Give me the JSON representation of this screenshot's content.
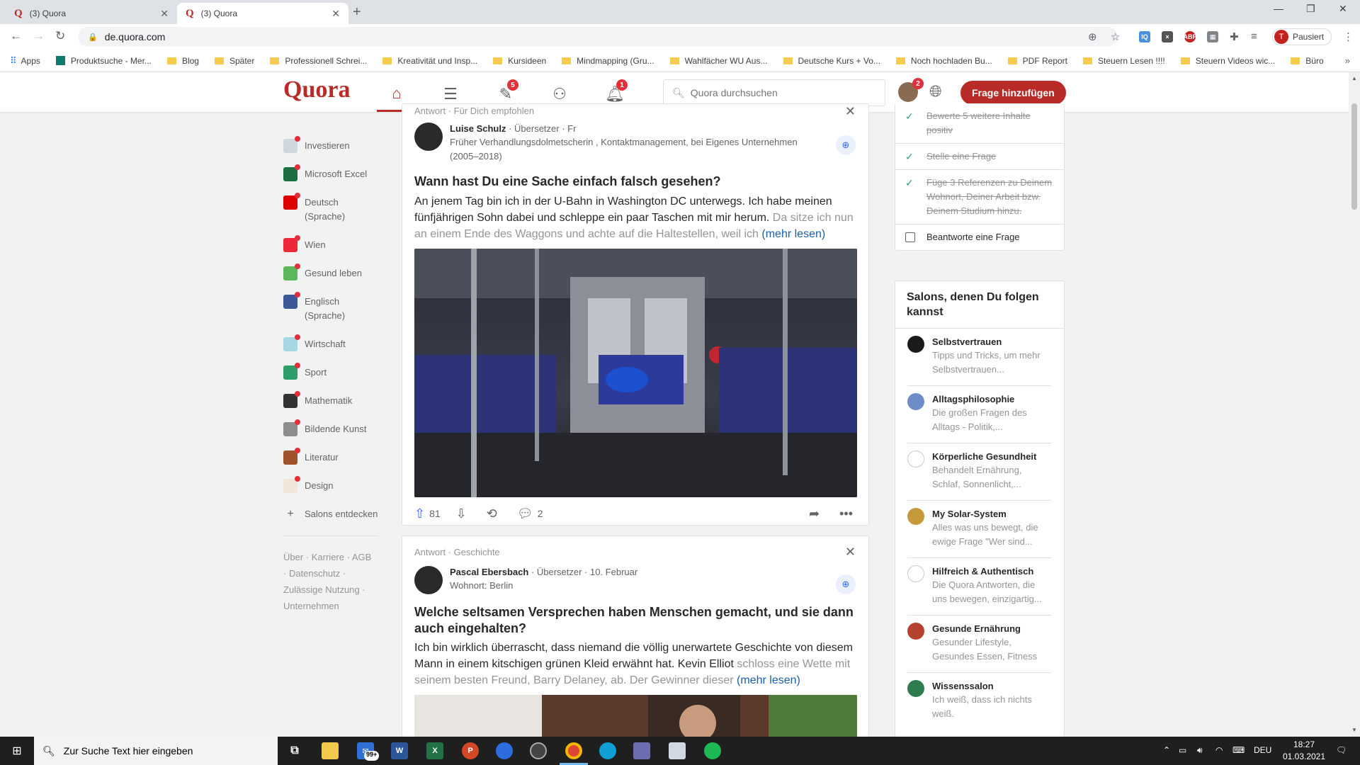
{
  "browser": {
    "tabs": [
      {
        "title": "(3) Quora",
        "active": false
      },
      {
        "title": "(3) Quora",
        "active": true
      }
    ],
    "url": "de.quora.com",
    "profile_label": "Pausiert",
    "profile_initial": "T",
    "bookmarks": [
      "Apps",
      "Produktsuche - Mer...",
      "Blog",
      "Später",
      "Professionell Schrei...",
      "Kreativität und Insp...",
      "Kursideen",
      "Mindmapping (Gru...",
      "Wahlfächer WU Aus...",
      "Deutsche Kurs + Vo...",
      "Noch hochladen Bu...",
      "PDF Report",
      "Steuern Lesen !!!!",
      "Steuern Videos wic...",
      "Büro"
    ]
  },
  "quora": {
    "logo": "Quora",
    "badges": {
      "answer": "5",
      "notifications": "1",
      "avatar": "2"
    },
    "search_placeholder": "Quora durchsuchen",
    "add_question": "Frage hinzufügen",
    "accent": "#b92b27"
  },
  "sidebar": {
    "spaces": [
      {
        "label": "Investieren",
        "color": "#cfd8dc"
      },
      {
        "label": "Microsoft Excel",
        "color": "#1d6f42"
      },
      {
        "label": "Deutsch (Sprache)",
        "color": "#dd0000"
      },
      {
        "label": "Wien",
        "color": "#ed2939"
      },
      {
        "label": "Gesund leben",
        "color": "#5cb85c"
      },
      {
        "label": "Englisch (Sprache)",
        "color": "#3b5998"
      },
      {
        "label": "Wirtschaft",
        "color": "#a6d8e3"
      },
      {
        "label": "Sport",
        "color": "#2e9e6b"
      },
      {
        "label": "Mathematik",
        "color": "#333333"
      },
      {
        "label": "Bildende Kunst",
        "color": "#8d8d8d"
      },
      {
        "label": "Literatur",
        "color": "#a0522d"
      },
      {
        "label": "Design",
        "color": "#f2e6d8"
      }
    ],
    "discover_label": "Salons entdecken",
    "footer_links": [
      "Über",
      "Karriere",
      "AGB",
      "Datenschutz",
      "Zulässige Nutzung",
      "Unternehmen"
    ]
  },
  "feed": [
    {
      "meta": "Antwort · Für Dich empfohlen",
      "author": "Luise Schulz",
      "author_meta": " · Übersetzer · Fr",
      "credential": "Früher Verhandlungsdolmetscherin , Kontaktmanagement, bei Eigenes Unternehmen (2005–2018)",
      "question": "Wann hast Du eine Sache einfach falsch gesehen?",
      "text": "An jenem Tag bin ich in der U-Bahn in Washington DC unterwegs. Ich habe meinen fünfjährigen Sohn dabei und schleppe ein paar Taschen mit mir herum. ",
      "text_fade": "Da sitze ich nun an einem Ende des Waggons und achte auf die Haltestellen, weil ich",
      "more": "(mehr lesen)",
      "upvotes": "81",
      "comments": "2"
    },
    {
      "meta": "Antwort · Geschichte",
      "author": "Pascal Ebersbach",
      "author_meta": " · Übersetzer · 10. Februar",
      "credential": "Wohnort: Berlin",
      "question": "Welche seltsamen Versprechen haben Menschen gemacht, und sie dann auch eingehalten?",
      "text": "Ich bin wirklich überrascht, dass niemand die völlig unerwartete Geschichte von diesem Mann in einem kitschigen grünen Kleid erwähnt hat. Kevin Elliot ",
      "text_fade": "schloss eine Wette mit seinem besten Freund, Barry Delaney, ab. Der Gewinner dieser",
      "more": "(mehr lesen)"
    }
  ],
  "tasks": [
    {
      "label": "Bewerte 5 weitere Inhalte positiv",
      "done": true
    },
    {
      "label": "Stelle eine Frage",
      "done": true
    },
    {
      "label": "Füge 3 Referenzen zu Deinem Wohnort, Deiner Arbeit bzw. Deinem Studium hinzu.",
      "done": true
    },
    {
      "label": "Beantworte eine Frage",
      "done": false
    }
  ],
  "salons": {
    "title": "Salons, denen Du folgen kannst",
    "items": [
      {
        "name": "Selbstvertrauen",
        "desc": "Tipps und Tricks, um mehr Selbstvertrauen...",
        "color": "#1a1a1a"
      },
      {
        "name": "Alltagsphilosophie",
        "desc": "Die großen Fragen des Alltags - Politik,...",
        "color": "#6b8cc7"
      },
      {
        "name": "Körperliche Gesundheit",
        "desc": "Behandelt Ernährung, Schlaf, Sonnenlicht,...",
        "color": "#ffffff"
      },
      {
        "name": "My Solar-System",
        "desc": "Alles was uns bewegt, die ewige Frage \"Wer sind...",
        "color": "#c49a3a"
      },
      {
        "name": "Hilfreich & Authentisch",
        "desc": "Die Quora Antworten, die uns bewegen, einzigartig...",
        "color": "#ffffff"
      },
      {
        "name": "Gesunde Ernährung",
        "desc": "Gesunder Lifestyle, Gesundes Essen, Fitness",
        "color": "#b5422f"
      },
      {
        "name": "Wissenssalon",
        "desc": "Ich weiß, dass ich nichts weiß.",
        "color": "#2e7d4f"
      }
    ]
  },
  "taskbar": {
    "search_placeholder": "Zur Suche Text hier eingeben",
    "mail_badge": "99+",
    "language": "DEU",
    "time": "18:27",
    "date": "01.03.2021"
  }
}
